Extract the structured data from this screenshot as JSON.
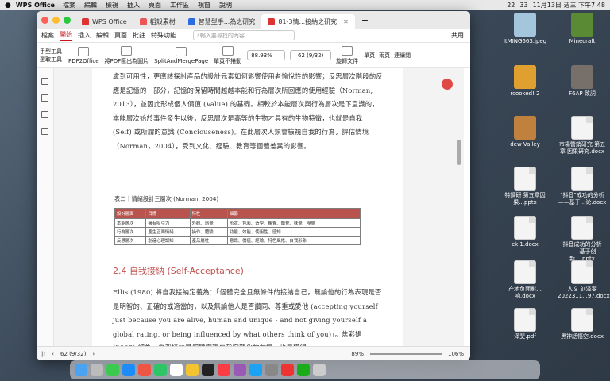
{
  "menubar": {
    "app": "WPS Office",
    "items": [
      "檔案",
      "編輯",
      "檢視",
      "插入",
      "頁面",
      "工作區",
      "視窗",
      "說明"
    ],
    "battery": "22",
    "notif": "33",
    "date": "11月13日 週三 下午7:48"
  },
  "desktop": [
    "ItMING663.jpeg",
    "Minecraft",
    "rcooked! 2",
    "F6AP 致詞",
    "dew Valley",
    "市場營銷研究 第五章 因果研究.docx",
    "特調研 第五章因果...pptx",
    "\"抖音\"成功的分析——基于...论.docx",
    "ck 1.docx",
    "抖音成功的分析——基于创新....pptx",
    "产地负面影...响.docx",
    "人文 刘泽斐 2022311...97.docx",
    "泽斐.pdf",
    "黑神話悟空.docx"
  ],
  "tabs": [
    "WPS Office",
    "稻殼素材",
    "智慧型手...為之研究",
    "81-3情...接納之研究"
  ],
  "menu": {
    "items": [
      "檔案",
      "開始",
      "插入",
      "編輯",
      "頁面",
      "批註",
      "特殊功能"
    ],
    "search": "輸入要尋找的內容",
    "share": "共用"
  },
  "toolbar": {
    "b1": "手型工具",
    "b2": "選取工具",
    "b3": "PDF2Office",
    "b4": "將PDF匯出為圖片",
    "b5": "SplitAndMergePage",
    "b6": "單頁不捲動",
    "zoom": "88.93%",
    "page": "62 (9/32)",
    "b7": "旋轉文件",
    "b8": "單頁",
    "b9": "兩頁",
    "b10": "連續閱"
  },
  "doc": {
    "p1": "盧到可用性，更應該探討產品的設計元素如何影響使用者愉悅性的影響；反思層次階段的反應是記憶的一部分，記憶的保留時間越越本能和行為層次所回應的使用經驗（Norman, 2013），並因此形成個人價值 (Value) 的基礎。相較於本能層次與行為層次是下意識的，本能層次始於事件發生以後，反思層次是高等的生物才具有的生物特徵，也就是自我 (Self) 或所謂的意識 (Conciouseness)。在此層次人類會檢視自我的行為，評估情境（Norman，2004），受到文化、經驗、教育等個體差異的影響。",
    "tcap": "表二｜情緒設計三層次 (Norman, 2004)",
    "thead": [
      "設計層面",
      "目標",
      "特性",
      "細節"
    ],
    "rows": [
      [
        "本能層次",
        "擁有吸引力",
        "外觀、感覺",
        "形狀、色彩、造型、觸覺、聽覺、味覺、嗅覺"
      ],
      [
        "行為層次",
        "產生正面情緒",
        "操作、體驗",
        "功能、效能、使用性、感知"
      ],
      [
        "反思層次",
        "創造心理認知",
        "產品屬性",
        "意識、價值、經驗、特色風格、自我形象"
      ]
    ],
    "h2": "2.4 自我接納 (Self-Acceptance)",
    "p2": "Ellis (1980) 將自我接納定義為：「個體完全且無條件的接納自己，無論他的行為表現是否是明智的、正確的或適當的，以及無論他人是否讚同、尊重或愛他 (accepting yourself just because you are alive, human and unique - and not giving yourself a global rating, or being influenced by what others think of you)」。焦彩娟 (2008) 認為，自我接納是個體實現自我客觀化的前提，也是獲得"
  },
  "status": {
    "page": "62 (9/32)",
    "zoom": "89%",
    "zoom2": "106%"
  }
}
